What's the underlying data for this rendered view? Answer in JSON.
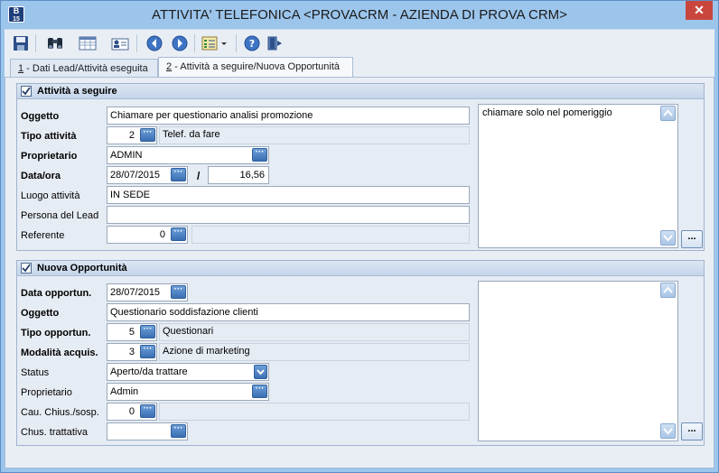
{
  "window": {
    "title": "ATTIVITA' TELEFONICA <PROVACRM - AZIENDA DI PROVA CRM>",
    "icon_text": "B",
    "icon_sub": "15",
    "close_label": "✕"
  },
  "toolbar": {
    "icons": [
      "save-icon",
      "binoculars-icon",
      "grid-icon",
      "contact-card-icon",
      "back-icon",
      "forward-icon",
      "list-dropdown-icon",
      "help-icon",
      "exit-icon"
    ]
  },
  "tabs": [
    {
      "hotkey": "1",
      "label": " - Dati Lead/Attività eseguita"
    },
    {
      "hotkey": "2",
      "label": " - Attività a seguire/Nuova Opportunità"
    }
  ],
  "activity": {
    "header": "Attività a seguire",
    "oggetto_label": "Oggetto",
    "oggetto_value": "Chiamare per questionario analisi promozione",
    "tipo_label": "Tipo attività",
    "tipo_code": "2",
    "tipo_desc": "Telef. da fare",
    "proprietario_label": "Proprietario",
    "proprietario_value": "ADMIN",
    "dataora_label": "Data/ora",
    "date_value": "28/07/2015",
    "slash": "/",
    "time_value": "16,56",
    "luogo_label": "Luogo attività",
    "luogo_value": "IN SEDE",
    "persona_label": "Persona del Lead",
    "persona_value": "",
    "referente_label": "Referente",
    "referente_code": "0",
    "referente_desc": "",
    "note_text": "chiamare solo nel pomeriggio",
    "note_button": "..."
  },
  "opportunity": {
    "header": "Nuova Opportunità",
    "data_label": "Data opportun.",
    "data_value": "28/07/2015",
    "oggetto_label": "Oggetto",
    "oggetto_value": "Questionario soddisfazione clienti",
    "tipo_label": "Tipo opportun.",
    "tipo_code": "5",
    "tipo_desc": "Questionari",
    "modalita_label": "Modalità acquis.",
    "modalita_code": "3",
    "modalita_desc": "Azione di marketing",
    "status_label": "Status",
    "status_value": "Aperto/da trattare",
    "proprietario_label": "Proprietario",
    "proprietario_value": "Admin",
    "cau_label": "Cau. Chius./sosp.",
    "cau_code": "0",
    "cau_desc": "",
    "chus_label": "Chus. trattativa",
    "chus_value": "",
    "note_text": "",
    "note_button": "..."
  }
}
